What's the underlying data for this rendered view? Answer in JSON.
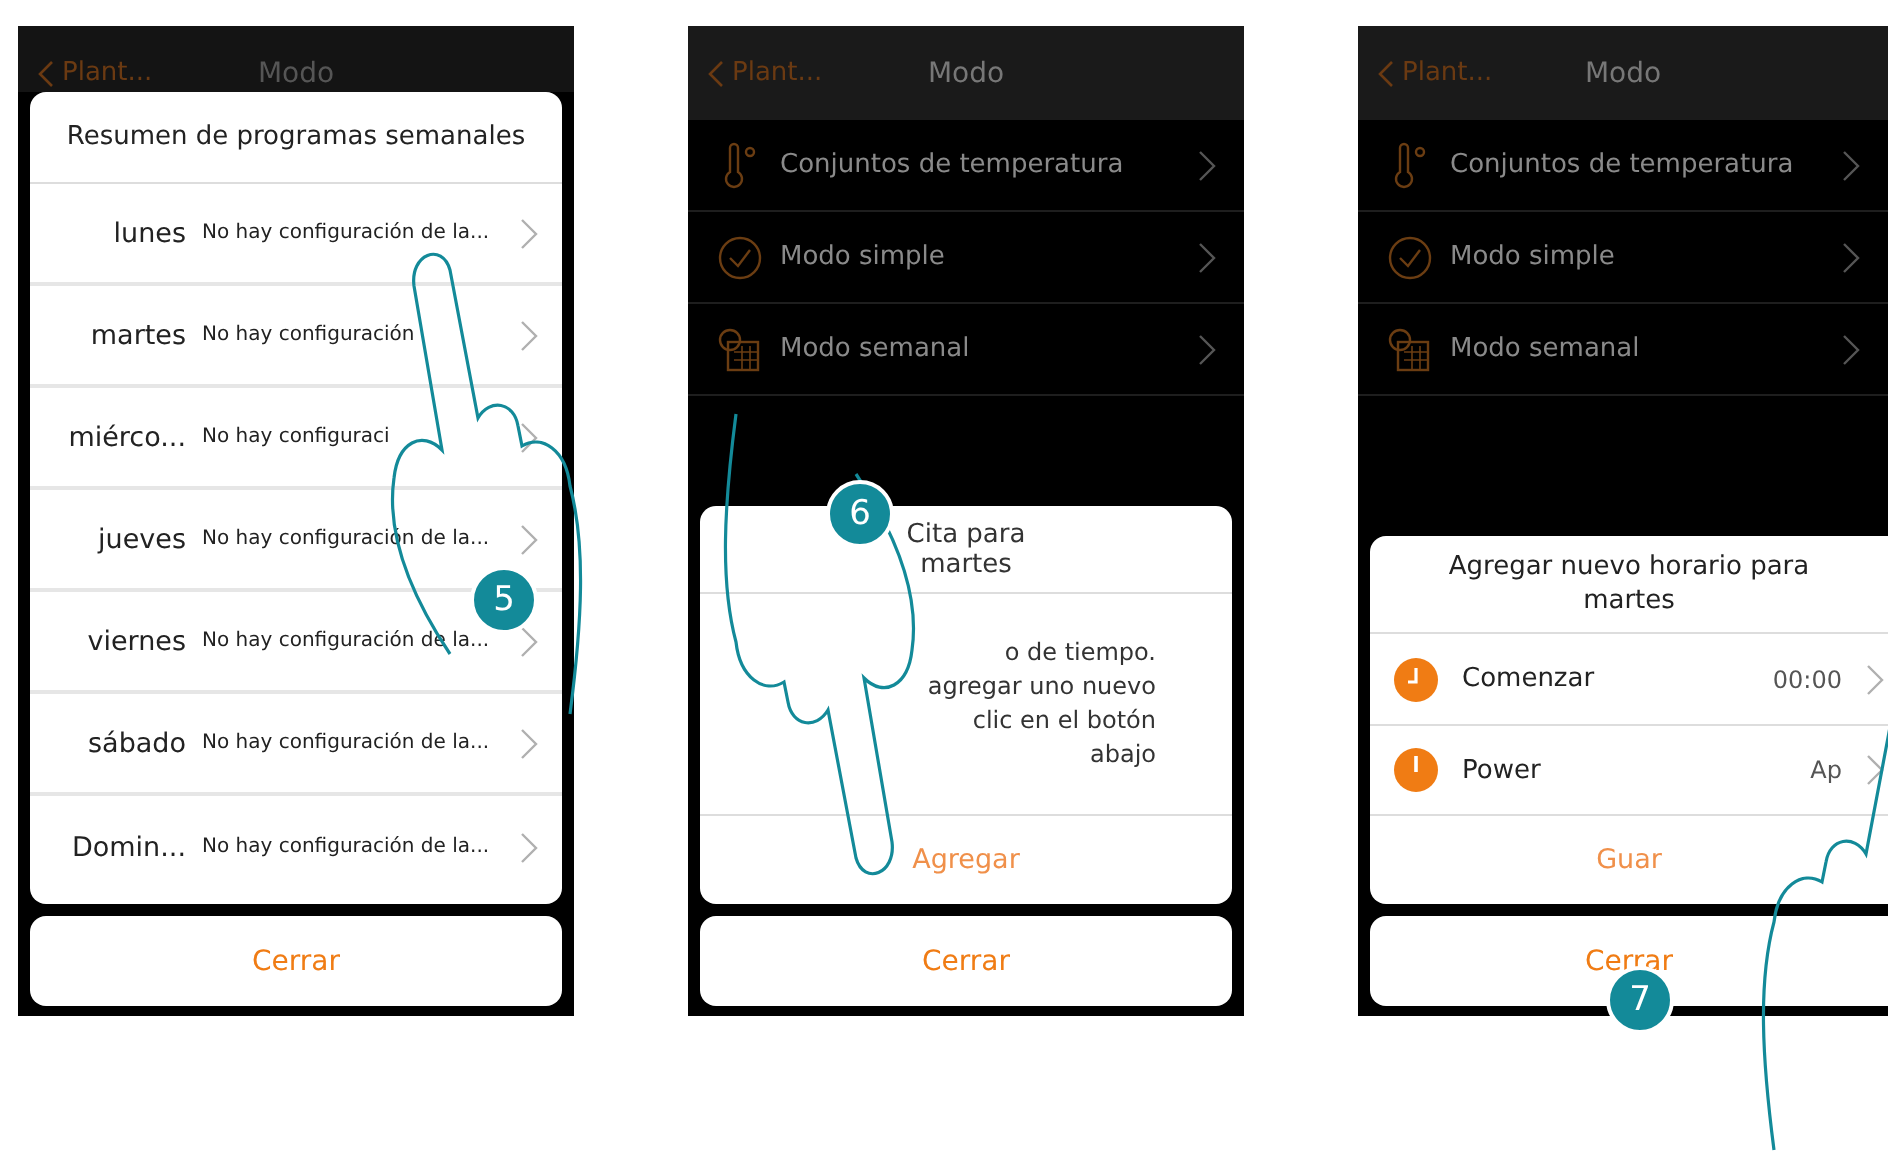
{
  "panels": [
    {
      "kind": "summary",
      "header": {
        "back": "Plant...",
        "title": "Modo"
      },
      "step": "5",
      "dialog": {
        "title": "Resumen de programas semanales",
        "rows": [
          {
            "day": "lunes",
            "status": "No hay configuración de la..."
          },
          {
            "day": "martes",
            "status": "No hay configuración"
          },
          {
            "day": "miérco...",
            "status": "No hay configuraci"
          },
          {
            "day": "jueves",
            "status": "No hay configuración de la..."
          },
          {
            "day": "viernes",
            "status": "No hay configuración de la..."
          },
          {
            "day": "sábado",
            "status": "No hay configuración de la..."
          },
          {
            "day": "Domin...",
            "status": "No hay configuración de la..."
          }
        ]
      },
      "close": "Cerrar"
    },
    {
      "kind": "empty",
      "header": {
        "back": "Plant...",
        "title": "Modo"
      },
      "menu": [
        {
          "label": "Conjuntos de temperatura"
        },
        {
          "label": "Modo simple"
        },
        {
          "label": "Modo semanal"
        }
      ],
      "step": "6",
      "dialog": {
        "title": "Cita para martes",
        "body_lines": [
          "o de tiempo.",
          "agregar uno nuevo",
          "clic en el botón",
          "abajo"
        ],
        "action": "Agregar"
      },
      "close": "Cerrar"
    },
    {
      "kind": "new",
      "header": {
        "back": "Plant...",
        "title": "Modo"
      },
      "menu": [
        {
          "label": "Conjuntos de temperatura"
        },
        {
          "label": "Modo simple"
        },
        {
          "label": "Modo semanal"
        }
      ],
      "step": "7",
      "dialog": {
        "title": "Agregar nuevo horario para martes",
        "rows": [
          {
            "label": "Comenzar",
            "value": "00:00"
          },
          {
            "label": "Power",
            "value": "Ap"
          }
        ],
        "action": "Guar"
      },
      "close": "Cerrar"
    }
  ]
}
